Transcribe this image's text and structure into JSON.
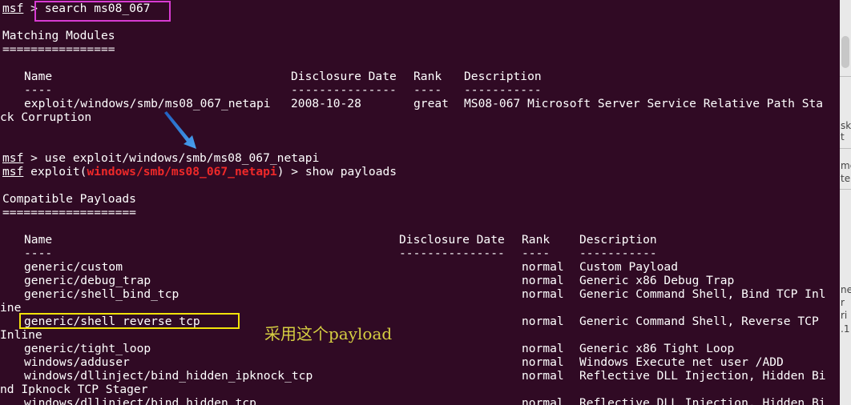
{
  "terminal": {
    "prompt": "msf",
    "cmd1": "search ms08_067",
    "matching_header": "Matching Modules",
    "matching_rule": "================",
    "modules_table": {
      "col_name": "Name",
      "col_date": "Disclosure Date",
      "col_rank": "Rank",
      "col_desc": "Description",
      "sep_name": "----",
      "sep_date": "---------------",
      "sep_rank": "----",
      "sep_desc": "-----------",
      "row_name": "exploit/windows/smb/ms08_067_netapi",
      "row_date": "2008-10-28",
      "row_rank": "great",
      "row_desc": "MS08-067 Microsoft Server Service Relative Path Sta",
      "row_wrap": "ck Corruption"
    },
    "cmd2": "use exploit/windows/smb/ms08_067_netapi",
    "exploit_prefix": "exploit(",
    "exploit_module": "windows/smb/ms08_067_netapi",
    "exploit_suffix": ") > ",
    "cmd3": "show payloads",
    "payloads_header": "Compatible Payloads",
    "payloads_rule": "===================",
    "payloads_table": {
      "col_name": "Name",
      "col_date": "Disclosure Date",
      "col_rank": "Rank",
      "col_desc": "Description",
      "sep_name": "----",
      "sep_date": "---------------",
      "sep_rank": "----",
      "sep_desc": "-----------",
      "rows": [
        {
          "name": "generic/custom",
          "rank": "normal",
          "desc": "Custom Payload"
        },
        {
          "name": "generic/debug_trap",
          "rank": "normal",
          "desc": "Generic x86 Debug Trap"
        },
        {
          "name": "generic/shell_bind_tcp",
          "rank": "normal",
          "desc": "Generic Command Shell, Bind TCP Inl",
          "wrap": "ine"
        },
        {
          "name": "generic/shell_reverse_tcp",
          "rank": "normal",
          "desc": "Generic Command Shell, Reverse TCP",
          "wrap": "Inline"
        },
        {
          "name": "generic/tight_loop",
          "rank": "normal",
          "desc": "Generic x86 Tight Loop"
        },
        {
          "name": "windows/adduser",
          "rank": "normal",
          "desc": "Windows Execute net user /ADD"
        },
        {
          "name": "windows/dllinject/bind_hidden_ipknock_tcp",
          "rank": "normal",
          "desc": "Reflective DLL Injection, Hidden Bi",
          "wrap": "nd Ipknock TCP Stager"
        },
        {
          "name": "windows/dllinject/bind_hidden_tcp",
          "rank": "normal",
          "desc": "Reflective DLL Injection, Hidden Bi"
        }
      ]
    }
  },
  "annotation": {
    "text": "采用这个payload",
    "box_colors": {
      "command": "#d83bd2",
      "payload": "#f2e30a"
    },
    "arrow_color": "#3a8ee6"
  },
  "side_panel": {
    "fragments": [
      "sk",
      "t",
      "me",
      "te",
      "ne",
      "r",
      "ri",
      ".1"
    ]
  }
}
